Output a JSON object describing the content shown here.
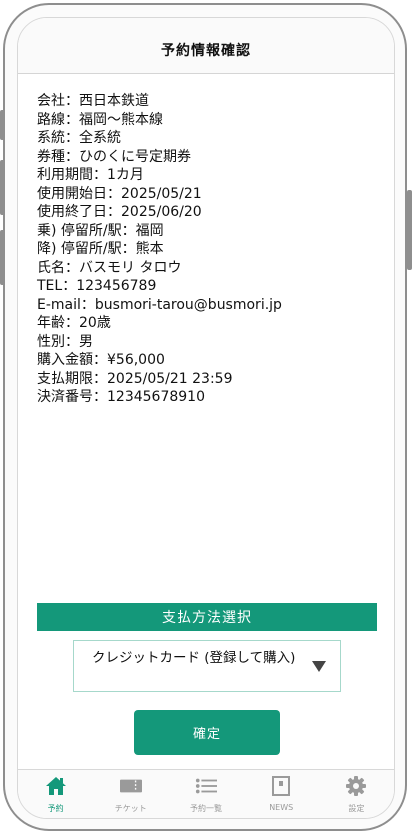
{
  "header": {
    "title": "予約情報確認"
  },
  "info_lines": [
    "会社：西日本鉄道",
    "路線：福岡〜熊本線",
    "系統：全系統",
    "券種：ひのくに号定期券",
    "利用期間：1カ月",
    "使用開始日：2025/05/21",
    "使用終了日：2025/06/20",
    "乗) 停留所/駅：福岡",
    "降) 停留所/駅：熊本",
    "氏名：バスモリ タロウ",
    "TEL：123456789",
    "E-mail：busmori-tarou@busmori.jp",
    "年齢：20歳",
    "性別：男",
    "購入金額：¥56,000",
    "支払期限：2025/05/21 23:59",
    "決済番号：12345678910"
  ],
  "payment": {
    "section_label": "支払方法選択",
    "selected_value": "クレジットカード (登録して購入)"
  },
  "confirm_button": "確定",
  "tabs": [
    {
      "label": "予約",
      "icon": "home-icon",
      "active": true
    },
    {
      "label": "チケット",
      "icon": "ticket-icon",
      "active": false
    },
    {
      "label": "予約一覧",
      "icon": "list-icon",
      "active": false
    },
    {
      "label": "NEWS",
      "icon": "news-icon",
      "active": false
    },
    {
      "label": "設定",
      "icon": "gear-icon",
      "active": false
    }
  ],
  "colors": {
    "accent": "#14987a",
    "inactive": "#9a9a9a",
    "frame": "#8e8e8e"
  }
}
